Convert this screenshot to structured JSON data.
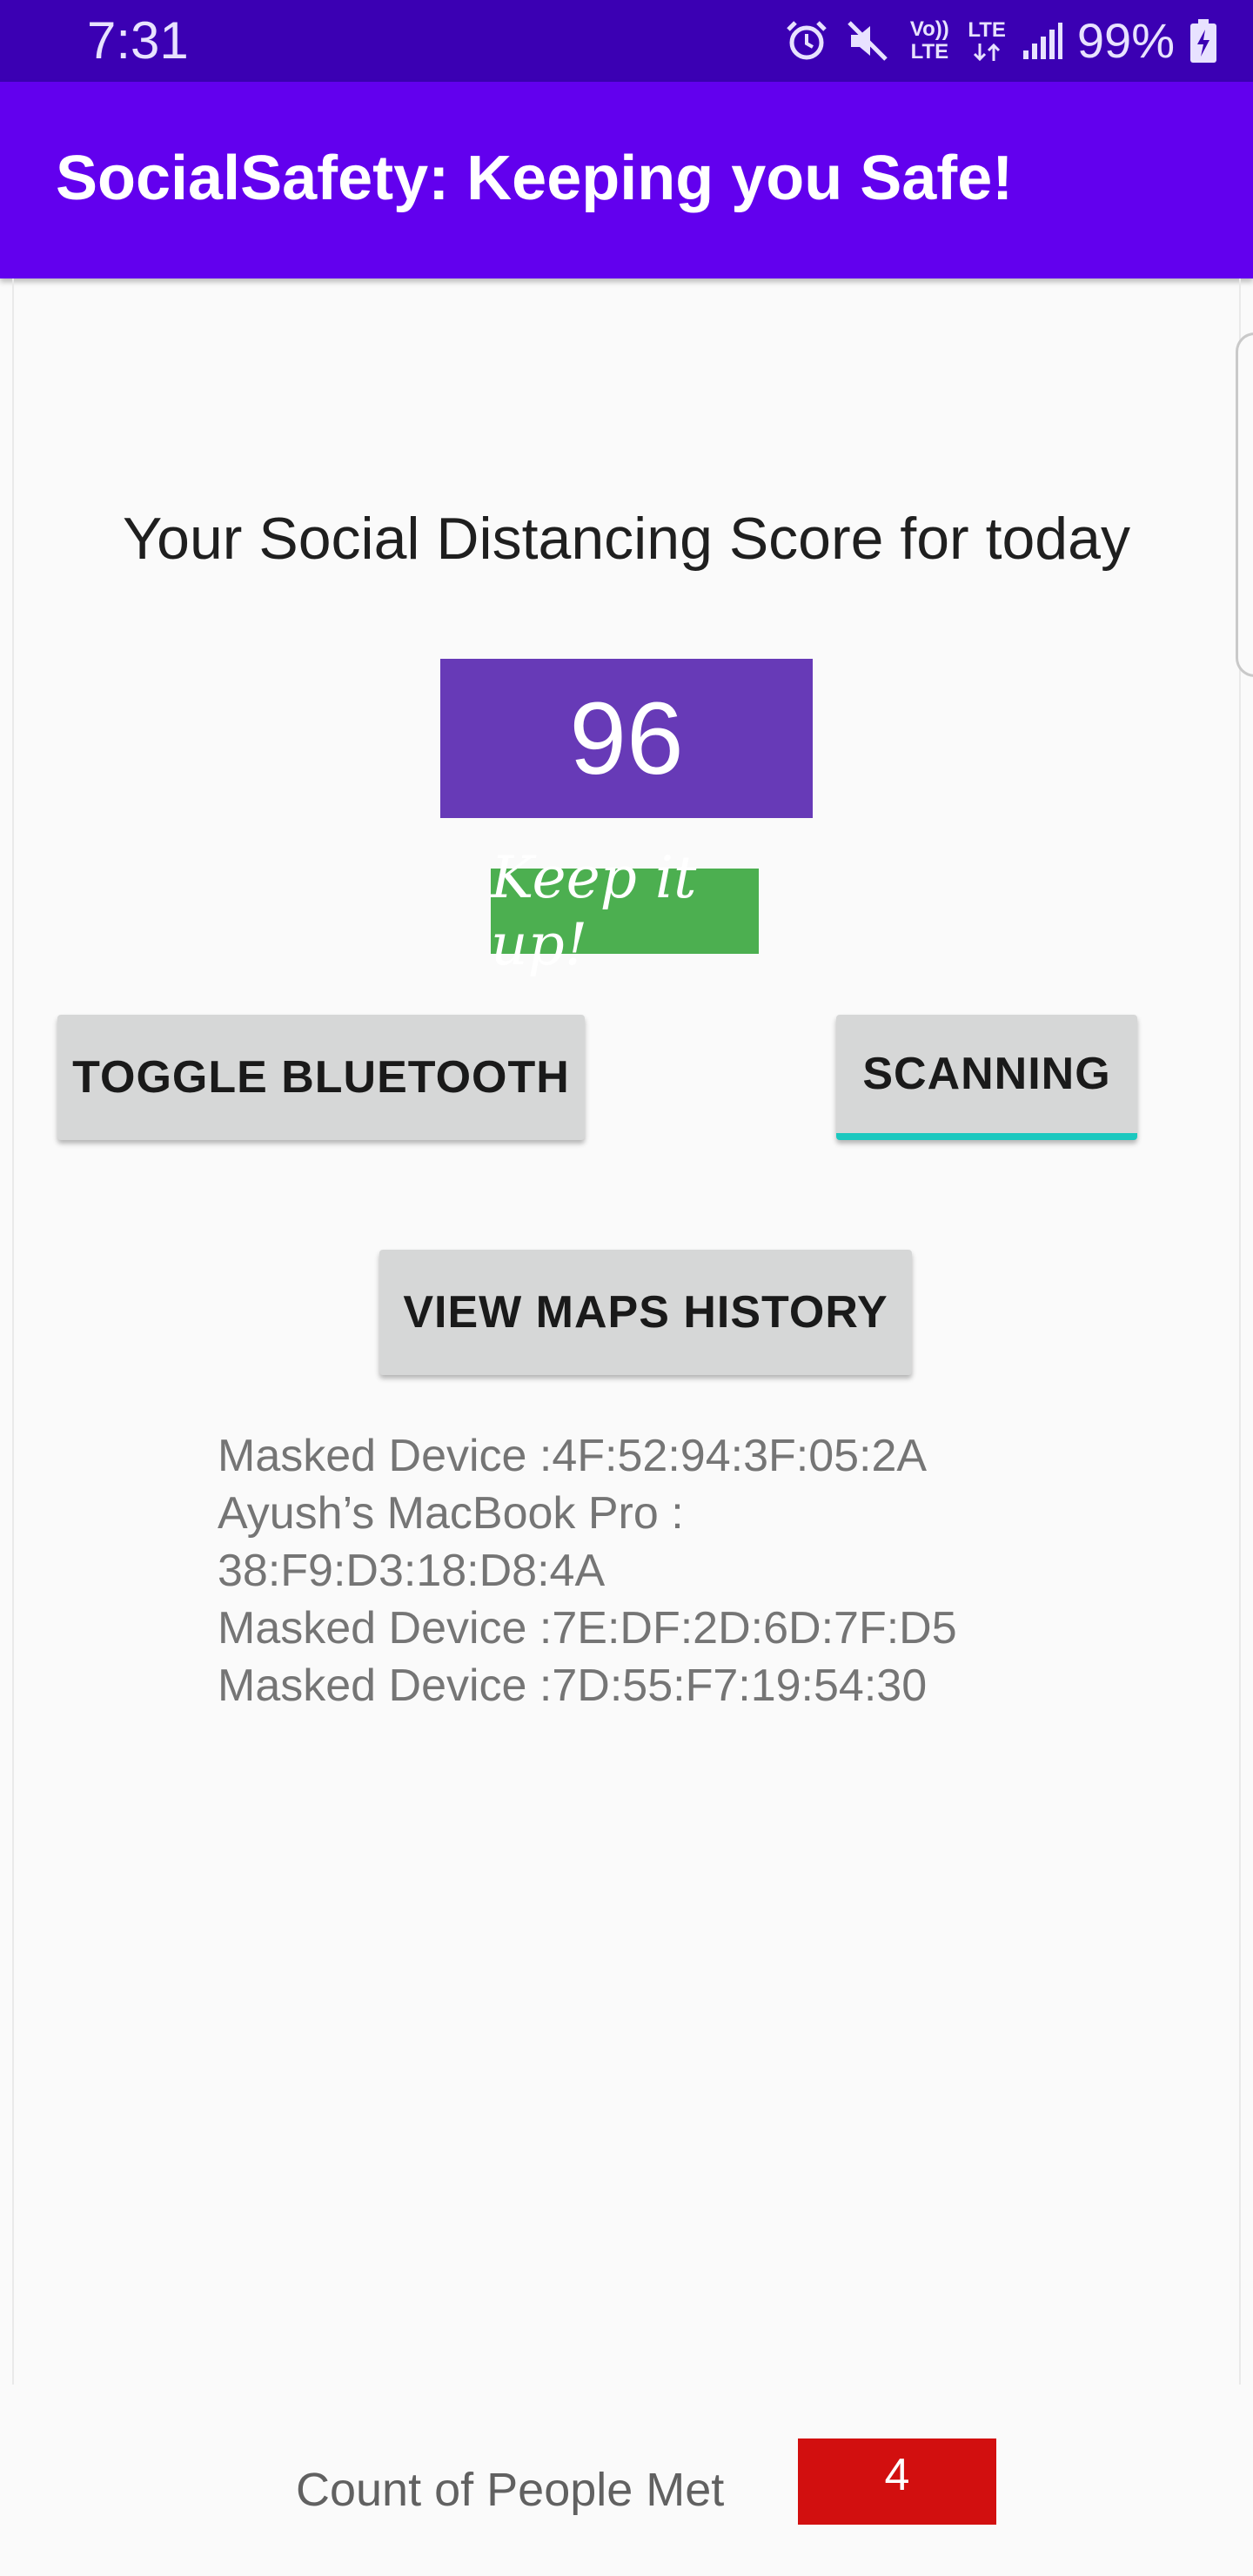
{
  "status_bar": {
    "time": "7:31",
    "battery": "99%",
    "icons": [
      "alarm-icon",
      "mute-icon",
      "volte-icon",
      "lte-icon",
      "signal-icon",
      "battery-charging-icon"
    ],
    "volte_label": "Vo)) LTE",
    "lte_label": "LTE"
  },
  "app_bar": {
    "title": "SocialSafety: Keeping you Safe!"
  },
  "main": {
    "score_title": "Your Social Distancing Score for today",
    "score_value": "96",
    "encouragement": "Keep it up!",
    "buttons": {
      "toggle_bluetooth": "TOGGLE BLUETOOTH",
      "scanning": "SCANNING",
      "view_maps_history": "VIEW MAPS HISTORY"
    },
    "devices": [
      "Masked Device :4F:52:94:3F:05:2A",
      "Ayush’s MacBook Pro :",
      "38:F9:D3:18:D8:4A",
      "Masked Device :7E:DF:2D:6D:7F:D5",
      "Masked Device :7D:55:F7:19:54:30"
    ]
  },
  "footer": {
    "label": "Count of People Met",
    "count": "4"
  },
  "colors": {
    "status_bar": "#3b00b3",
    "app_bar": "#6200ee",
    "score_box": "#673ab7",
    "encouragement_badge": "#4caf50",
    "scanning_underline": "#1cc8bf",
    "count_box": "#d20f0f"
  }
}
